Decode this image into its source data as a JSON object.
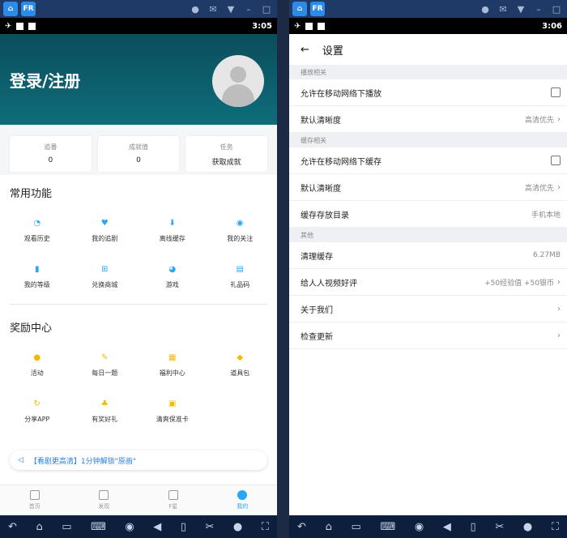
{
  "left_phone": {
    "time": "3:05",
    "title": "登录/注册",
    "stats": [
      {
        "label": "追番",
        "value": "0"
      },
      {
        "label": "成就值",
        "value": "0"
      },
      {
        "label": "任务",
        "value": "获取成就"
      }
    ],
    "common_title": "常用功能",
    "common_items": [
      {
        "label": "观看历史",
        "icon": "clock-icon",
        "color": "#2aa6f2"
      },
      {
        "label": "我的追剧",
        "icon": "heart-icon",
        "color": "#2aa6f2"
      },
      {
        "label": "离线缓存",
        "icon": "download-icon",
        "color": "#2aa6f2"
      },
      {
        "label": "我的关注",
        "icon": "eye-icon",
        "color": "#2aa6f2"
      },
      {
        "label": "我的等级",
        "icon": "level-icon",
        "color": "#2aa6f2"
      },
      {
        "label": "兑换商城",
        "icon": "cart-icon",
        "color": "#2aa6f2"
      },
      {
        "label": "游戏",
        "icon": "pacman-icon",
        "color": "#2aa6f2"
      },
      {
        "label": "礼品码",
        "icon": "gift-card-icon",
        "color": "#2aa6f2"
      }
    ],
    "reward_title": "奖励中心",
    "reward_items": [
      {
        "label": "活动",
        "icon": "balloon-icon",
        "color": "#f5b800"
      },
      {
        "label": "每日一题",
        "icon": "quiz-icon",
        "color": "#f5b800"
      },
      {
        "label": "福利中心",
        "icon": "gift-icon",
        "color": "#f5b800"
      },
      {
        "label": "道具包",
        "icon": "bag-icon",
        "color": "#f5b800"
      },
      {
        "label": "分享APP",
        "icon": "share-icon",
        "color": "#f5b800"
      },
      {
        "label": "有奖好礼",
        "icon": "money-bag-icon",
        "color": "#f5b800"
      },
      {
        "label": "清爽保准卡",
        "icon": "card-icon",
        "color": "#f5b800"
      }
    ],
    "notice": "【看剧更高清】1分钟解锁\"原画\"",
    "tabs": [
      {
        "label": "首页",
        "active": false
      },
      {
        "label": "发现",
        "active": false
      },
      {
        "label": "F星",
        "active": false
      },
      {
        "label": "我的",
        "active": true
      }
    ]
  },
  "right_phone": {
    "time": "3:06",
    "title": "设置",
    "groups": [
      {
        "title": "播放相关",
        "rows": [
          {
            "label": "允许在移动网络下播放",
            "type": "checkbox"
          },
          {
            "label": "默认清晰度",
            "type": "link",
            "value": "高清优先"
          }
        ]
      },
      {
        "title": "缓存相关",
        "rows": [
          {
            "label": "允许在移动网络下缓存",
            "type": "checkbox"
          },
          {
            "label": "默认清晰度",
            "type": "link",
            "value": "高清优先"
          },
          {
            "label": "缓存存放目录",
            "type": "value",
            "value": "手机本地"
          }
        ]
      },
      {
        "title": "其他",
        "rows": [
          {
            "label": "清理缓存",
            "type": "value",
            "value": "6.27MB"
          },
          {
            "label": "给人人视频好评",
            "type": "link",
            "value": "+50经验值 +50银币"
          },
          {
            "label": "关于我们",
            "type": "link",
            "value": ""
          },
          {
            "label": "检查更新",
            "type": "link",
            "value": ""
          }
        ]
      }
    ]
  },
  "colors": {
    "accent": "#2aa6f2",
    "hero": "#0b4d5c",
    "reward": "#f5b800"
  }
}
